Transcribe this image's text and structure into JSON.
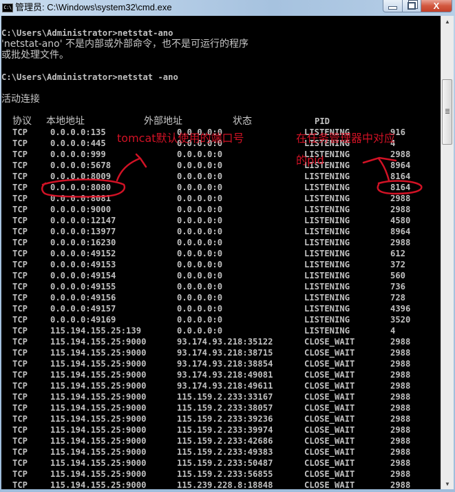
{
  "window": {
    "title": "管理员: C:\\Windows\\system32\\cmd.exe",
    "icon": "cmd-icon",
    "icon_text": "C:\\",
    "buttons": {
      "minimize": "minimize-icon",
      "maximize": "restore-icon",
      "close": "close-icon",
      "close_glyph": "X"
    }
  },
  "console": {
    "lines_top": [
      {
        "text": "C:\\Users\\Administrator>netstat-ano",
        "cjk": false
      },
      {
        "text": "'netstat-ano' 不是内部或外部命令，也不是可运行的程序",
        "cjk": true
      },
      {
        "text": "或批处理文件。",
        "cjk": true
      },
      {
        "text": "",
        "cjk": false
      },
      {
        "text": "C:\\Users\\Administrator>netstat -ano",
        "cjk": false
      },
      {
        "text": "",
        "cjk": false
      },
      {
        "text": "活动连接",
        "cjk": true
      },
      {
        "text": "",
        "cjk": false
      }
    ],
    "table_headers": {
      "protocol": "协议",
      "local_address": "本地地址",
      "foreign_address": "外部地址",
      "state": "状态",
      "pid": "PID"
    },
    "rows": [
      {
        "proto": "TCP",
        "local": "0.0.0.0:135",
        "foreign": "0.0.0.0:0",
        "state": "LISTENING",
        "pid": "916"
      },
      {
        "proto": "TCP",
        "local": "0.0.0.0:445",
        "foreign": "0.0.0.0:0",
        "state": "LISTENING",
        "pid": "4"
      },
      {
        "proto": "TCP",
        "local": "0.0.0.0:999",
        "foreign": "0.0.0.0:0",
        "state": "LISTENING",
        "pid": "2988"
      },
      {
        "proto": "TCP",
        "local": "0.0.0.0:5678",
        "foreign": "0.0.0.0:0",
        "state": "LISTENING",
        "pid": "8964"
      },
      {
        "proto": "TCP",
        "local": "0.0.0.0:8009",
        "foreign": "0.0.0.0:0",
        "state": "LISTENING",
        "pid": "8164"
      },
      {
        "proto": "TCP",
        "local": "0.0.0.0:8080",
        "foreign": "0.0.0.0:0",
        "state": "LISTENING",
        "pid": "8164"
      },
      {
        "proto": "TCP",
        "local": "0.0.0.0:8081",
        "foreign": "0.0.0.0:0",
        "state": "LISTENING",
        "pid": "2988"
      },
      {
        "proto": "TCP",
        "local": "0.0.0.0:9000",
        "foreign": "0.0.0.0:0",
        "state": "LISTENING",
        "pid": "2988"
      },
      {
        "proto": "TCP",
        "local": "0.0.0.0:12147",
        "foreign": "0.0.0.0:0",
        "state": "LISTENING",
        "pid": "4580"
      },
      {
        "proto": "TCP",
        "local": "0.0.0.0:13977",
        "foreign": "0.0.0.0:0",
        "state": "LISTENING",
        "pid": "8964"
      },
      {
        "proto": "TCP",
        "local": "0.0.0.0:16230",
        "foreign": "0.0.0.0:0",
        "state": "LISTENING",
        "pid": "2988"
      },
      {
        "proto": "TCP",
        "local": "0.0.0.0:49152",
        "foreign": "0.0.0.0:0",
        "state": "LISTENING",
        "pid": "612"
      },
      {
        "proto": "TCP",
        "local": "0.0.0.0:49153",
        "foreign": "0.0.0.0:0",
        "state": "LISTENING",
        "pid": "372"
      },
      {
        "proto": "TCP",
        "local": "0.0.0.0:49154",
        "foreign": "0.0.0.0:0",
        "state": "LISTENING",
        "pid": "560"
      },
      {
        "proto": "TCP",
        "local": "0.0.0.0:49155",
        "foreign": "0.0.0.0:0",
        "state": "LISTENING",
        "pid": "736"
      },
      {
        "proto": "TCP",
        "local": "0.0.0.0:49156",
        "foreign": "0.0.0.0:0",
        "state": "LISTENING",
        "pid": "728"
      },
      {
        "proto": "TCP",
        "local": "0.0.0.0:49157",
        "foreign": "0.0.0.0:0",
        "state": "LISTENING",
        "pid": "4396"
      },
      {
        "proto": "TCP",
        "local": "0.0.0.0:49169",
        "foreign": "0.0.0.0:0",
        "state": "LISTENING",
        "pid": "3520"
      },
      {
        "proto": "TCP",
        "local": "115.194.155.25:139",
        "foreign": "0.0.0.0:0",
        "state": "LISTENING",
        "pid": "4"
      },
      {
        "proto": "TCP",
        "local": "115.194.155.25:9000",
        "foreign": "93.174.93.218:35122",
        "state": "CLOSE_WAIT",
        "pid": "2988"
      },
      {
        "proto": "TCP",
        "local": "115.194.155.25:9000",
        "foreign": "93.174.93.218:38715",
        "state": "CLOSE_WAIT",
        "pid": "2988"
      },
      {
        "proto": "TCP",
        "local": "115.194.155.25:9000",
        "foreign": "93.174.93.218:38854",
        "state": "CLOSE_WAIT",
        "pid": "2988"
      },
      {
        "proto": "TCP",
        "local": "115.194.155.25:9000",
        "foreign": "93.174.93.218:49081",
        "state": "CLOSE_WAIT",
        "pid": "2988"
      },
      {
        "proto": "TCP",
        "local": "115.194.155.25:9000",
        "foreign": "93.174.93.218:49611",
        "state": "CLOSE_WAIT",
        "pid": "2988"
      },
      {
        "proto": "TCP",
        "local": "115.194.155.25:9000",
        "foreign": "115.159.2.233:33167",
        "state": "CLOSE_WAIT",
        "pid": "2988"
      },
      {
        "proto": "TCP",
        "local": "115.194.155.25:9000",
        "foreign": "115.159.2.233:38057",
        "state": "CLOSE_WAIT",
        "pid": "2988"
      },
      {
        "proto": "TCP",
        "local": "115.194.155.25:9000",
        "foreign": "115.159.2.233:39236",
        "state": "CLOSE_WAIT",
        "pid": "2988"
      },
      {
        "proto": "TCP",
        "local": "115.194.155.25:9000",
        "foreign": "115.159.2.233:39974",
        "state": "CLOSE_WAIT",
        "pid": "2988"
      },
      {
        "proto": "TCP",
        "local": "115.194.155.25:9000",
        "foreign": "115.159.2.233:42686",
        "state": "CLOSE_WAIT",
        "pid": "2988"
      },
      {
        "proto": "TCP",
        "local": "115.194.155.25:9000",
        "foreign": "115.159.2.233:49383",
        "state": "CLOSE_WAIT",
        "pid": "2988"
      },
      {
        "proto": "TCP",
        "local": "115.194.155.25:9000",
        "foreign": "115.159.2.233:50487",
        "state": "CLOSE_WAIT",
        "pid": "2988"
      },
      {
        "proto": "TCP",
        "local": "115.194.155.25:9000",
        "foreign": "115.159.2.233:56855",
        "state": "CLOSE_WAIT",
        "pid": "2988"
      },
      {
        "proto": "TCP",
        "local": "115.194.155.25:9000",
        "foreign": "115.239.228.8:18848",
        "state": "CLOSE_WAIT",
        "pid": "2988"
      }
    ]
  },
  "annotations": {
    "tomcat_port_note": "tomcat默认使用的端口号",
    "pid_note_line1": "在任务管理器中对应",
    "pid_note_line2": "的pid",
    "color": "#e8142a"
  },
  "scrollbar": {
    "up_icon": "scroll-up-arrow-icon",
    "down_icon": "scroll-down-arrow-icon",
    "up_glyph": "▲",
    "down_glyph": "▼"
  }
}
